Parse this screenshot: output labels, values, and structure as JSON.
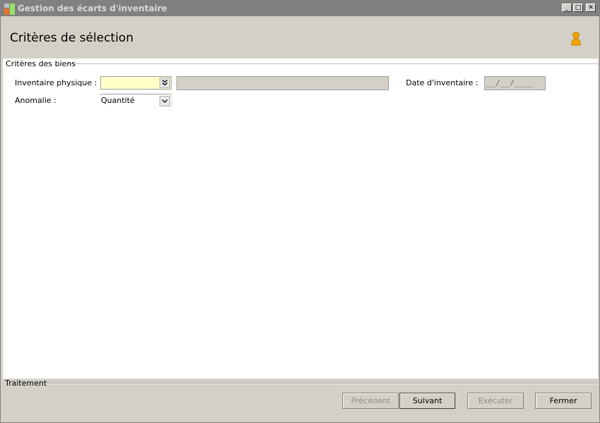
{
  "window": {
    "title": "Gestion des écarts d'inventaire",
    "controls": {
      "minimize": "_",
      "maximize": "□",
      "close": "✕"
    }
  },
  "header": {
    "title": "Critères de sélection",
    "user_icon": "user-icon"
  },
  "criteria": {
    "group_label": "Critères des biens",
    "inventaire_label": "Inventaire physique :",
    "inventaire_value": "",
    "inventaire_desc": "",
    "date_label": "Date d'inventaire :",
    "date_value": "__/__/____",
    "anomalie_label": "Anomalie :",
    "anomalie_value": "Quantité"
  },
  "footer": {
    "group_label": "Traitement",
    "buttons": {
      "precedent": "Précédent",
      "suivant": "Suivant",
      "executer": "Exécuter",
      "fermer": "Fermer"
    }
  },
  "colors": {
    "required_field": "#ffffc8",
    "window_bg": "#d4d0c8",
    "titlebar": "#808080"
  }
}
